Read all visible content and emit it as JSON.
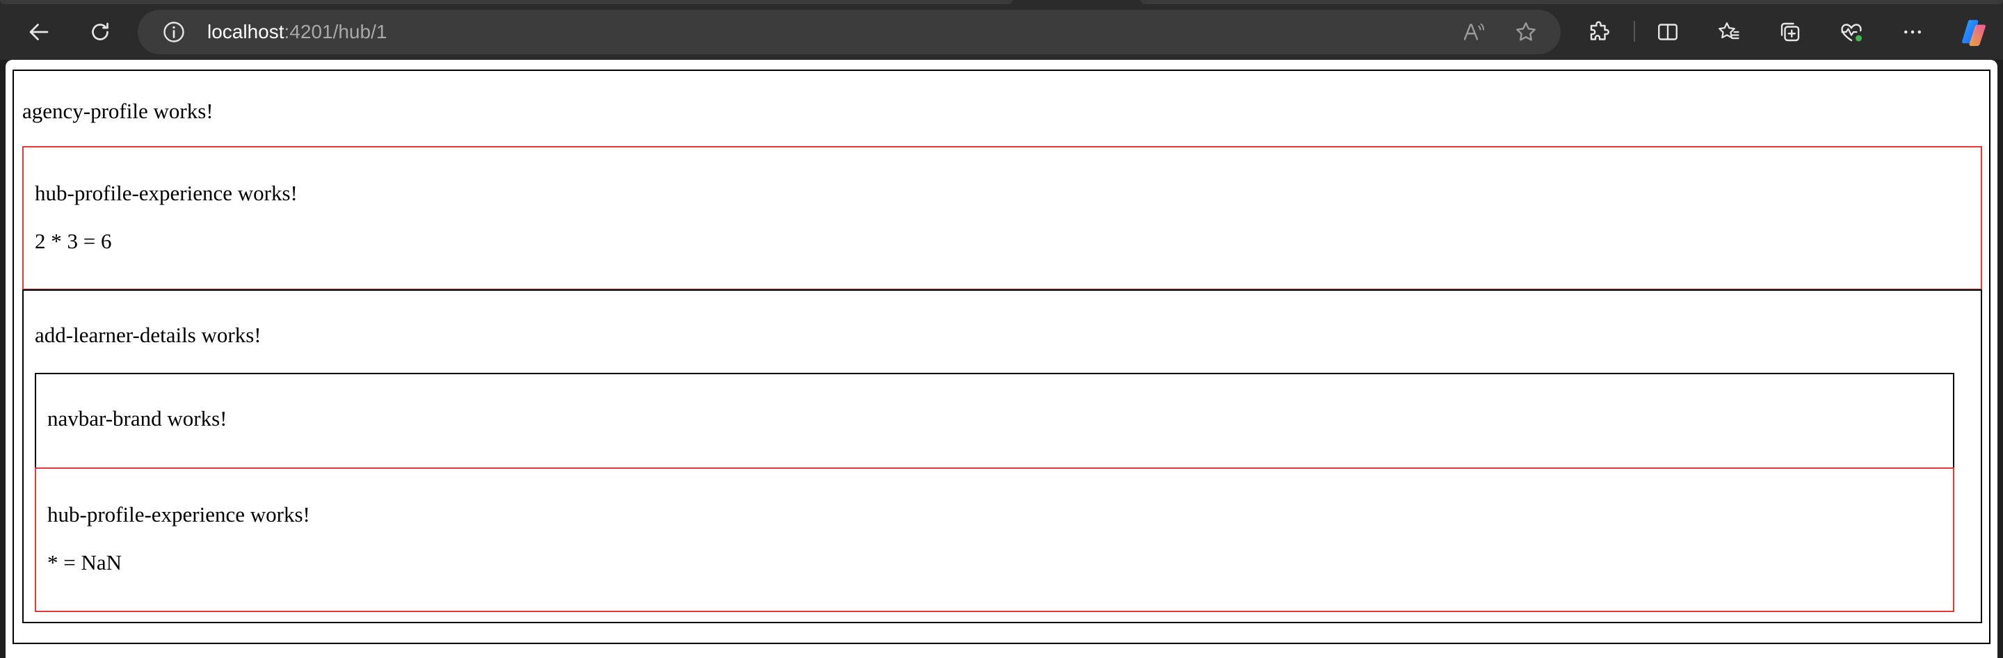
{
  "browser": {
    "url_host": "localhost",
    "url_path": ":4201/hub/1",
    "icons": {
      "back": "arrow-left-icon",
      "refresh": "refresh-icon",
      "site_info": "info-icon",
      "read_aloud": "read-aloud-icon",
      "favorite": "star-icon",
      "extensions": "puzzle-icon",
      "split_screen": "split-screen-icon",
      "favorites": "favorites-list-icon",
      "collections": "collections-icon",
      "performance": "heart-pulse-icon",
      "more": "more-dots-icon",
      "copilot": "copilot-icon"
    },
    "colors": {
      "toolbar_bg": "#2b2b2b",
      "address_bg": "#3c3c3c",
      "performance_dot": "#3fb950"
    }
  },
  "page": {
    "agency_profile": {
      "text": "agency-profile works!"
    },
    "hub_profile_experience_1": {
      "title": "hub-profile-experience works!",
      "result": "2 * 3 = 6"
    },
    "add_learner_details": {
      "title": "add-learner-details works!",
      "navbar_brand": "navbar-brand works!",
      "hub_profile_experience_2": {
        "title": "hub-profile-experience works!",
        "result": "* = NaN"
      }
    },
    "colors": {
      "outer_border": "#000000",
      "experience_border": "#e53935"
    }
  }
}
